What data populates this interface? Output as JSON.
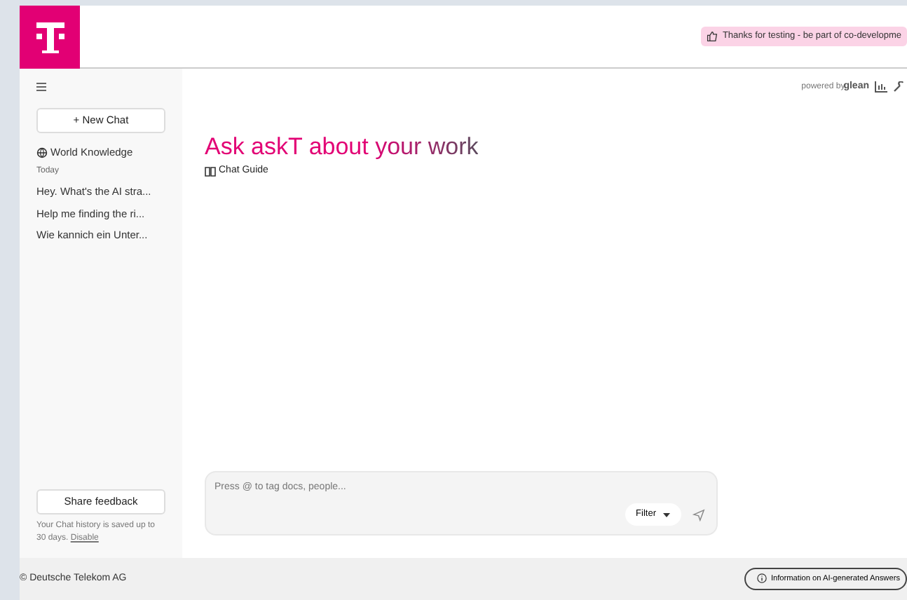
{
  "header": {
    "banner": "Thanks for testing - be part of co-developme"
  },
  "sidebar": {
    "new_chat": "+ New Chat",
    "world_knowledge": "World Knowledge",
    "section": "Today",
    "chats": [
      {
        "title": "Hey. What's the AI stra..."
      },
      {
        "title": "Help me finding the ri..."
      },
      {
        "title": "Wie kannich ein Unter..."
      }
    ],
    "feedback": "Share feedback",
    "history_note": "Your Chat history is saved up to 30 days.",
    "disable_link": "Disable"
  },
  "main": {
    "powered_by": "powered by",
    "brand": "glean",
    "title": "Ask askT about your work",
    "guide": "Chat Guide",
    "composer": {
      "placeholder": "Press @ to tag docs, people...",
      "filter": "Filter"
    }
  },
  "footer": {
    "copyright": "© Deutsche Telekom AG",
    "info": "Information on AI-generated Answers"
  }
}
